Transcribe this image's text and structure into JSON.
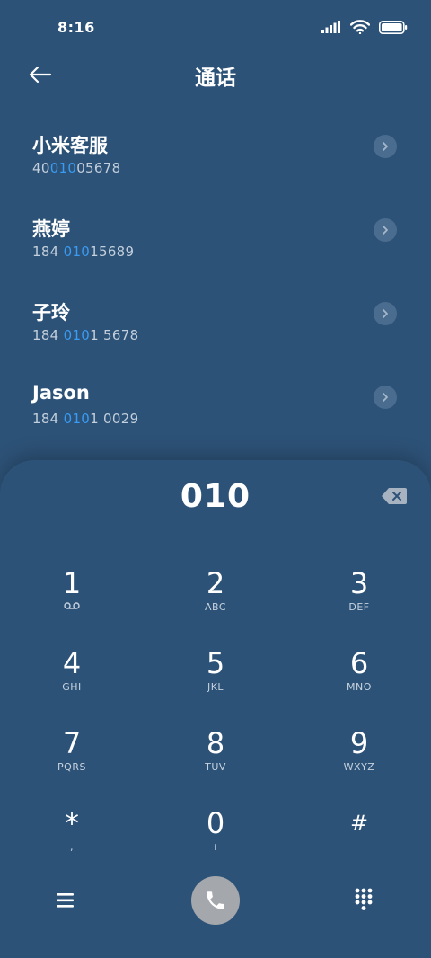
{
  "status_bar": {
    "time": "8:16",
    "icons": [
      "signal-icon",
      "wifi-icon",
      "battery-icon"
    ]
  },
  "header": {
    "title": "通话",
    "back_icon": "arrow-left-icon"
  },
  "contacts": [
    {
      "name": "小米客服",
      "number_pre": "40",
      "number_hl": "010",
      "number_post": "05678"
    },
    {
      "name": "燕婷",
      "number_pre": "184 ",
      "number_hl": "010",
      "number_post": "15689"
    },
    {
      "name": "子玲",
      "number_pre": "184 ",
      "number_hl": "010",
      "number_post": "1 5678"
    },
    {
      "name": "Jason",
      "number_pre": "184 ",
      "number_hl": "010",
      "number_post": "1 0029"
    }
  ],
  "dialer": {
    "input": "010",
    "keys": [
      {
        "digit": "1",
        "sub": "voicemail-icon"
      },
      {
        "digit": "2",
        "sub": "ABC"
      },
      {
        "digit": "3",
        "sub": "DEF"
      },
      {
        "digit": "4",
        "sub": "GHI"
      },
      {
        "digit": "5",
        "sub": "JKL"
      },
      {
        "digit": "6",
        "sub": "MNO"
      },
      {
        "digit": "7",
        "sub": "PQRS"
      },
      {
        "digit": "8",
        "sub": "TUV"
      },
      {
        "digit": "9",
        "sub": "WXYZ"
      },
      {
        "digit": "*",
        "sub": ","
      },
      {
        "digit": "0",
        "sub": "+"
      },
      {
        "digit": "#",
        "sub": ""
      }
    ]
  },
  "colors": {
    "background": "#2d5277",
    "highlight": "#3a9bf2",
    "call_button": "#a4a7ab",
    "arrow_circle": "#4a6c8e"
  }
}
